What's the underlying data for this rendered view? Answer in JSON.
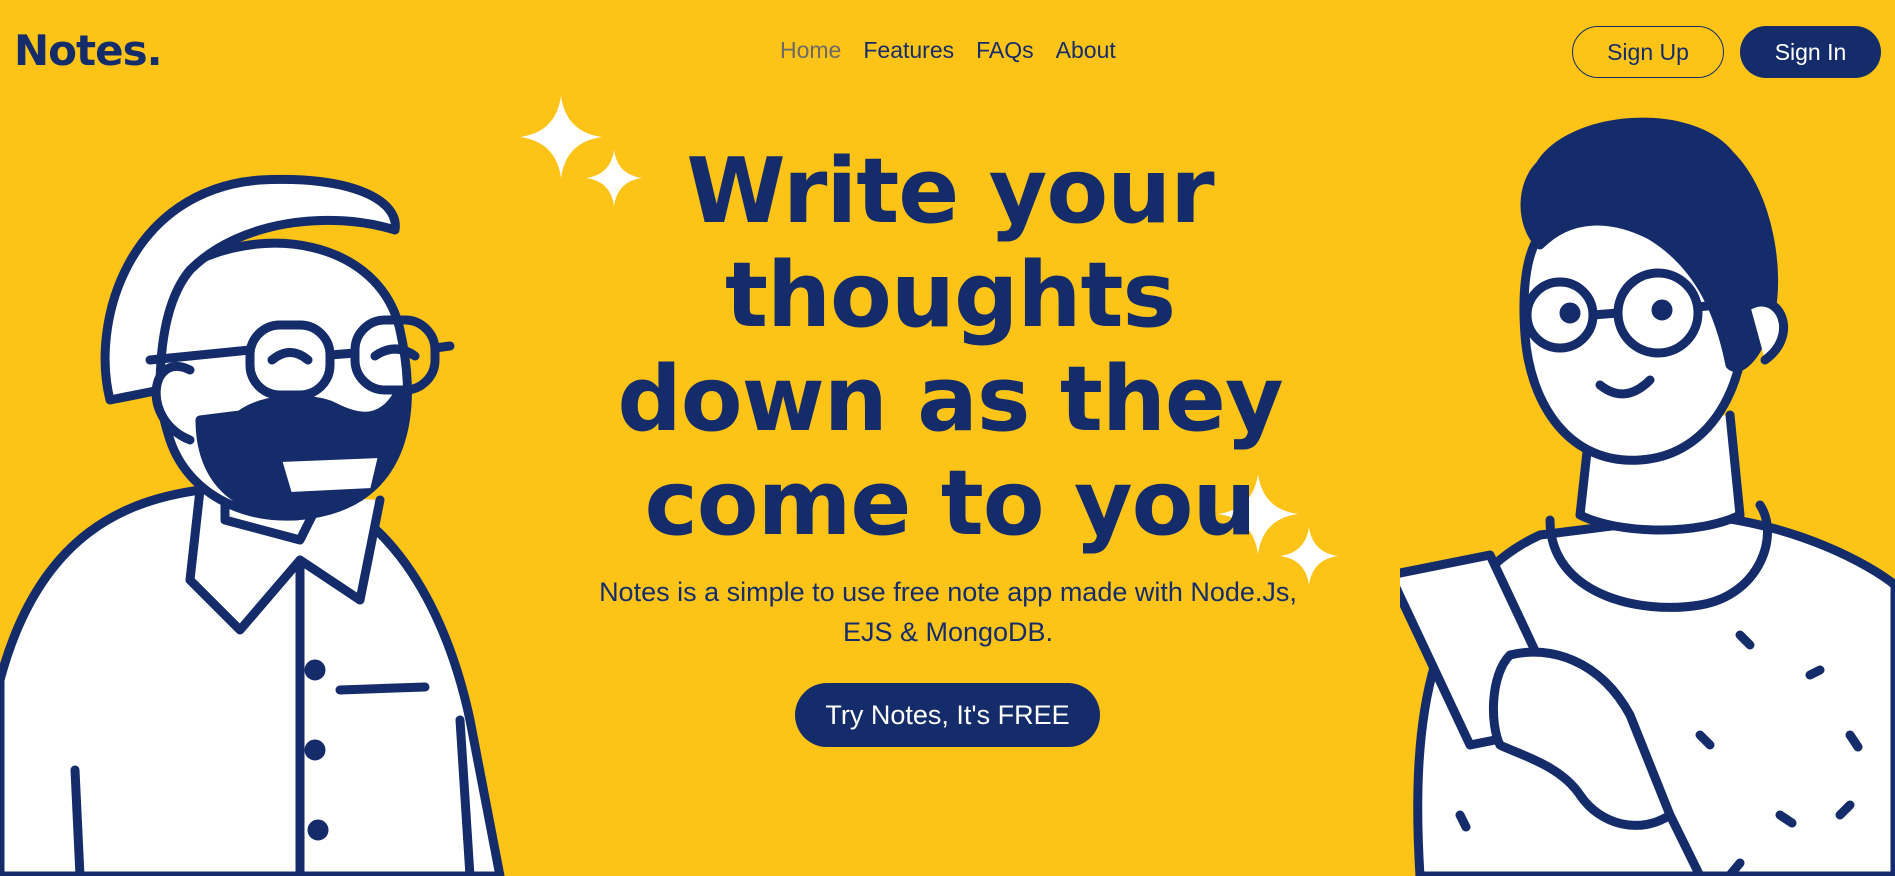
{
  "brand": {
    "logo": "Notes."
  },
  "nav": {
    "items": [
      {
        "label": "Home"
      },
      {
        "label": "Features"
      },
      {
        "label": "FAQs"
      },
      {
        "label": "About"
      }
    ]
  },
  "auth": {
    "signup_label": "Sign Up",
    "signin_label": "Sign In"
  },
  "hero": {
    "headline_lines": [
      "Write your",
      "thoughts",
      "down as they",
      "come to you"
    ],
    "subtitle_line1": "Notes is a simple to use free note app made with Node.Js,",
    "subtitle_line2": "EJS & MongoDB.",
    "cta_label": "Try Notes, It's FREE"
  },
  "colors": {
    "background": "#FDC417",
    "primary": "#152C6B",
    "muted_nav": "#6B6A66",
    "white": "#FFFFFF"
  }
}
